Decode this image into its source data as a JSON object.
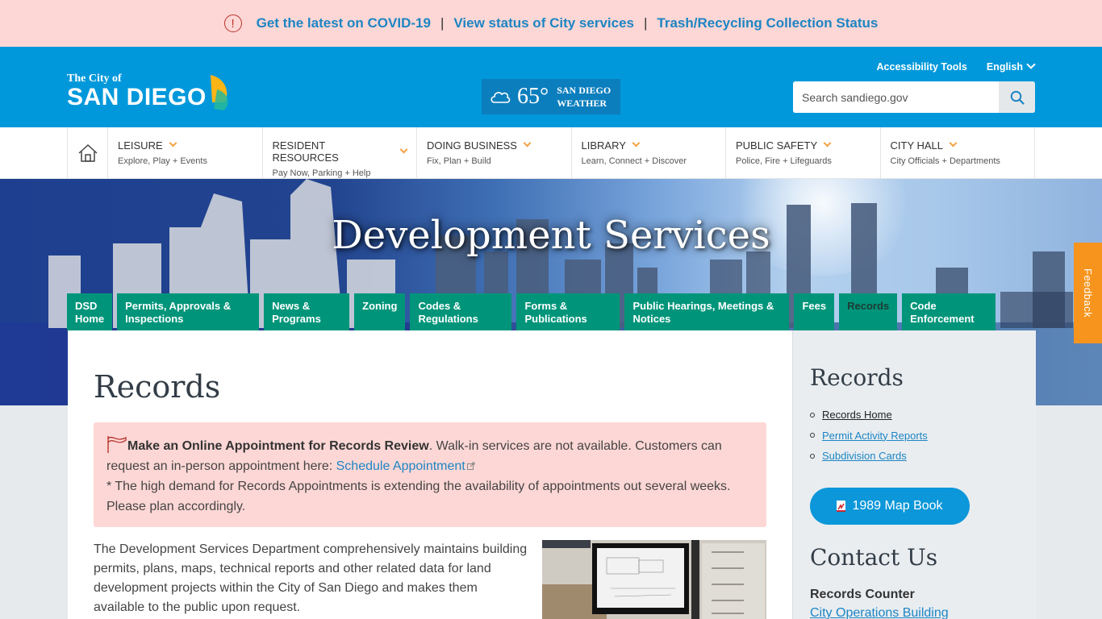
{
  "alert": {
    "icon": "exclamation-circle-icon",
    "links": [
      {
        "label": "Get the latest on COVID-19"
      },
      {
        "label": "View status of City services"
      },
      {
        "label": "Trash/Recycling Collection Status"
      }
    ],
    "separator": "|"
  },
  "header": {
    "logo": {
      "small": "The City of",
      "big": "SAN DIEGO"
    },
    "weather": {
      "icon": "cloud-icon",
      "temperature": "65°",
      "line1": "SAN DIEGO",
      "line2": "WEATHER"
    },
    "accessibility_label": "Accessibility Tools",
    "language": "English",
    "search": {
      "placeholder": "Search sandiego.gov",
      "value": ""
    }
  },
  "main_nav": {
    "home_icon": "home-icon",
    "items": [
      {
        "title": "LEISURE",
        "subtitle": "Explore, Play + Events"
      },
      {
        "title": "RESIDENT RESOURCES",
        "subtitle": "Pay Now, Parking + Help"
      },
      {
        "title": "DOING BUSINESS",
        "subtitle": "Fix, Plan + Build"
      },
      {
        "title": "LIBRARY",
        "subtitle": "Learn, Connect + Discover"
      },
      {
        "title": "PUBLIC SAFETY",
        "subtitle": "Police, Fire + Lifeguards"
      },
      {
        "title": "CITY HALL",
        "subtitle": "City Officials + Departments"
      }
    ]
  },
  "hero": {
    "title": "Development Services"
  },
  "sub_nav": {
    "tabs": [
      {
        "line1": "DSD",
        "line2": "Home"
      },
      {
        "line1": "Permits, Approvals &",
        "line2": "Inspections"
      },
      {
        "line1": "News &",
        "line2": "Programs"
      },
      {
        "line1": "Zoning",
        "line2": ""
      },
      {
        "line1": "Codes &",
        "line2": "Regulations"
      },
      {
        "line1": "Forms &",
        "line2": "Publications"
      },
      {
        "line1": "Public Hearings, Meetings &",
        "line2": "Notices"
      },
      {
        "line1": "Fees",
        "line2": ""
      },
      {
        "line1": "Records",
        "line2": ""
      },
      {
        "line1": "Code",
        "line2": "Enforcement"
      }
    ],
    "active_tab": "Records",
    "colors": {
      "tab_bg": "#00957a"
    }
  },
  "feedback": {
    "label": "Feedback"
  },
  "main": {
    "title": "Records",
    "notice": {
      "bold": "Make an Online Appointment for Records Review",
      "text1": ". Walk-in services are not available. Customers can request an in-person appointment here: ",
      "link": "Schedule Appointment",
      "text2": "* The high demand for Records Appointments is extending the availability of appointments out several weeks. Please plan accordingly."
    },
    "intro": "The Development Services Department comprehensively maintains building permits, plans, maps, technical reports and other related data for land development projects within the City of San Diego and makes them available to the public upon request."
  },
  "sidebar": {
    "title": "Records",
    "links": [
      {
        "label": "Records Home",
        "current": true
      },
      {
        "label": "Permit Activity Reports",
        "current": false
      },
      {
        "label": "Subdivision Cards",
        "current": false
      }
    ],
    "map_book_label": "1989 Map Book",
    "contact_title": "Contact Us",
    "counter_label": "Records Counter",
    "building_link": "City Operations Building"
  },
  "colors": {
    "alert_bg": "#fdd7d5",
    "header_bg": "#0098db",
    "link": "#1d85c4",
    "accent_orange": "#f5a345",
    "feedback": "#f7941d"
  }
}
